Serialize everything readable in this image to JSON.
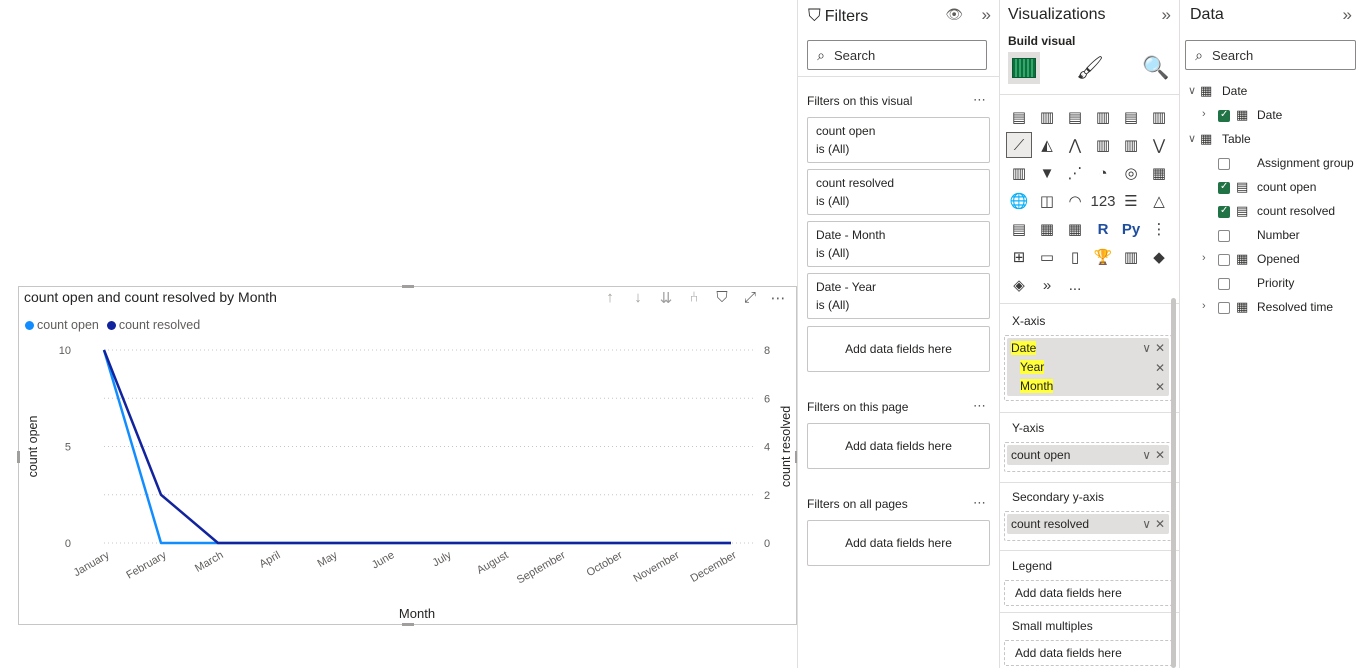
{
  "visual": {
    "title": "count open and count resolved by Month",
    "legend": [
      {
        "label": "count open",
        "color": "#118DFF"
      },
      {
        "label": "count resolved",
        "color": "#12239E"
      }
    ],
    "toolbar": [
      "↑",
      "↓",
      "⇊",
      "⑃",
      "filter-icon",
      "focus-icon",
      "more-icon"
    ]
  },
  "chart_data": {
    "type": "line",
    "categories": [
      "January",
      "February",
      "March",
      "April",
      "May",
      "June",
      "July",
      "August",
      "September",
      "October",
      "November",
      "December"
    ],
    "series": [
      {
        "name": "count open",
        "axis": "left",
        "color": "#118DFF",
        "values": [
          10,
          0,
          0,
          0,
          0,
          0,
          0,
          0,
          0,
          0,
          0,
          0
        ]
      },
      {
        "name": "count resolved",
        "axis": "right",
        "color": "#12239E",
        "values": [
          8,
          2,
          0,
          0,
          0,
          0,
          0,
          0,
          0,
          0,
          0,
          0
        ]
      }
    ],
    "xlabel": "Month",
    "ylabel": "count open",
    "y2label": "count resolved",
    "ylim": [
      0,
      10
    ],
    "y2lim": [
      0,
      8
    ],
    "yticks": [
      0,
      5,
      10
    ],
    "y2ticks": [
      0,
      2,
      4,
      6,
      8
    ],
    "grid": true,
    "legend_position": "top-left"
  },
  "filters": {
    "title": "Filters",
    "search_placeholder": "Search",
    "on_visual_label": "Filters on this visual",
    "cards": [
      {
        "field": "count open",
        "state": "is (All)"
      },
      {
        "field": "count resolved",
        "state": "is (All)"
      },
      {
        "field": "Date - Month",
        "state": "is (All)"
      },
      {
        "field": "Date - Year",
        "state": "is (All)"
      }
    ],
    "add_fields": "Add data fields here",
    "on_page_label": "Filters on this page",
    "on_all_pages_label": "Filters on all pages",
    "more": "..."
  },
  "viz": {
    "title": "Visualizations",
    "build_visual": "Build visual",
    "xaxis_label": "X-axis",
    "xaxis_fields": [
      "Date",
      "Year",
      "Month"
    ],
    "yaxis_label": "Y-axis",
    "yaxis_field": "count open",
    "secondary_label": "Secondary y-axis",
    "secondary_field": "count resolved",
    "legend_label": "Legend",
    "small_multiples_label": "Small multiples",
    "add_fields": "Add data fields here",
    "icons": [
      "▤",
      "▥",
      "▤",
      "▥",
      "▤",
      "▥",
      "⟋",
      "◭",
      "⋀",
      "▥",
      "▥",
      "⋁",
      "▥",
      "▼",
      "⋰",
      "◔",
      "◎",
      "▦",
      "🌐",
      "◫",
      "◠",
      "123",
      "☰",
      "△",
      "▤",
      "▦",
      "▦",
      "R",
      "Py",
      "⋮",
      "⊞",
      "▭",
      "▯",
      "🏆",
      "▥",
      "◆",
      "◈",
      "»",
      "..."
    ]
  },
  "data": {
    "title": "Data",
    "search_placeholder": "Search",
    "tree": [
      {
        "label": "Date",
        "level": 0,
        "chevron": "v",
        "checkbox": null,
        "icon": "table-icon"
      },
      {
        "label": "Date",
        "level": 1,
        "chevron": ">",
        "checkbox": true,
        "icon": "calendar-icon"
      },
      {
        "label": "Table",
        "level": 0,
        "chevron": "v",
        "checkbox": null,
        "icon": "table-icon"
      },
      {
        "label": "Assignment group",
        "level": 1,
        "chevron": "",
        "checkbox": false,
        "icon": ""
      },
      {
        "label": "count open",
        "level": 1,
        "chevron": "",
        "checkbox": true,
        "icon": "calculator-icon"
      },
      {
        "label": "count resolved",
        "level": 1,
        "chevron": "",
        "checkbox": true,
        "icon": "calculator-icon"
      },
      {
        "label": "Number",
        "level": 1,
        "chevron": "",
        "checkbox": false,
        "icon": ""
      },
      {
        "label": "Opened",
        "level": 1,
        "chevron": ">",
        "checkbox": false,
        "icon": "calendar-icon"
      },
      {
        "label": "Priority",
        "level": 1,
        "chevron": "",
        "checkbox": false,
        "icon": ""
      },
      {
        "label": "Resolved time",
        "level": 1,
        "chevron": ">",
        "checkbox": false,
        "icon": "calendar-icon"
      }
    ]
  }
}
